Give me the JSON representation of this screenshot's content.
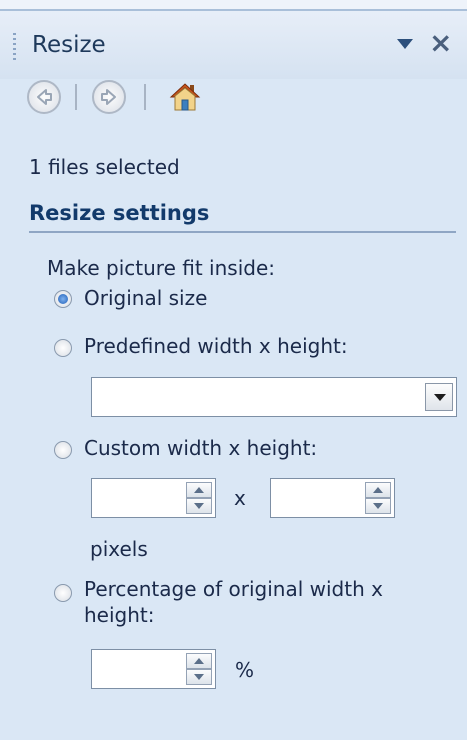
{
  "panel": {
    "title": "Resize"
  },
  "toolbar": {
    "back_icon": "back-arrow-icon",
    "forward_icon": "forward-arrow-icon",
    "home_icon": "home-icon"
  },
  "selection": {
    "files_selected": "1 files selected"
  },
  "settings": {
    "heading": "Resize settings",
    "fit_label": "Make picture fit inside:",
    "options": [
      {
        "label": "Original size",
        "selected": true
      },
      {
        "label": "Predefined width x height:",
        "selected": false
      },
      {
        "label": "Custom width x height:",
        "selected": false
      },
      {
        "label": "Percentage of original width x",
        "label_line2": "height:",
        "selected": false
      }
    ],
    "predefined_value": "",
    "custom": {
      "width": "",
      "height": "",
      "separator": "x",
      "unit": "pixels"
    },
    "percentage": {
      "value": "",
      "unit": "%"
    }
  }
}
